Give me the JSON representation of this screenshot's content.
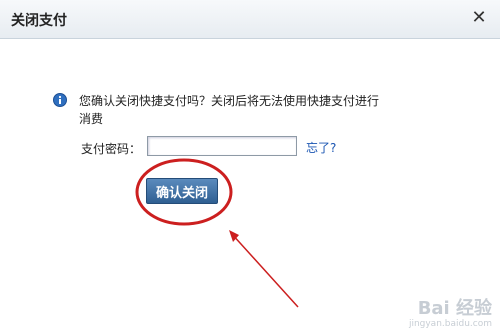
{
  "dialog": {
    "title": "关闭支付",
    "close_icon": "close-icon",
    "message": "您确认关闭快捷支付吗？关闭后将无法使用快捷支付进行消费",
    "info_icon": "info-icon",
    "password_label": "支付密码：",
    "password_value": "",
    "forgot_link": "忘了?",
    "confirm_button": "确认关闭"
  },
  "annotation": {
    "color": "#cc1f1f"
  },
  "watermark": {
    "brand": "Bai 经验",
    "url": "jingyan.baidu.com"
  }
}
